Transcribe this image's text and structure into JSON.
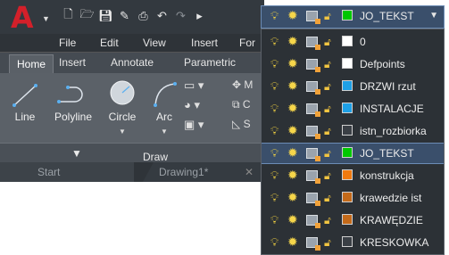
{
  "app": {
    "logo_letter": "A"
  },
  "qat_icons": [
    "new-icon",
    "open-icon",
    "save-icon",
    "saveas-icon",
    "plot-icon",
    "undo-icon",
    "redo-icon",
    "more-icon"
  ],
  "menu": {
    "file": "File",
    "edit": "Edit",
    "view": "View",
    "insert": "Insert",
    "format": "For"
  },
  "ribbon_tabs": {
    "home": "Home",
    "insert": "Insert",
    "annotate": "Annotate",
    "parametric": "Parametric"
  },
  "draw_tools": {
    "line": "Line",
    "polyline": "Polyline",
    "circle": "Circle",
    "arc": "Arc"
  },
  "modify_partial": {
    "m": "M",
    "c": "C",
    "s": "S"
  },
  "panel_title": "Draw",
  "file_tabs": {
    "start": "Start",
    "drawing": "Drawing1*"
  },
  "current_layer": {
    "name": "JO_TEKST",
    "color": "#00c800"
  },
  "layers": [
    {
      "name": "0",
      "color": "#ffffff",
      "selected": false
    },
    {
      "name": "Defpoints",
      "color": "#ffffff",
      "selected": false
    },
    {
      "name": "DRZWI rzut",
      "color": "#1ea0e6",
      "selected": false
    },
    {
      "name": "INSTALACJE",
      "color": "#1ea0e6",
      "selected": false
    },
    {
      "name": "istn_rozbiorka",
      "color": "#3a3f45",
      "selected": false
    },
    {
      "name": "JO_TEKST",
      "color": "#00c800",
      "selected": true
    },
    {
      "name": "konstrukcja",
      "color": "#f07a10",
      "selected": false
    },
    {
      "name": "krawedzie ist",
      "color": "#c46a1a",
      "selected": false
    },
    {
      "name": "KRAWĘDZIE",
      "color": "#c46a1a",
      "selected": false
    },
    {
      "name": "KRESKOWKA",
      "color": "#3a3f45",
      "selected": false
    }
  ]
}
